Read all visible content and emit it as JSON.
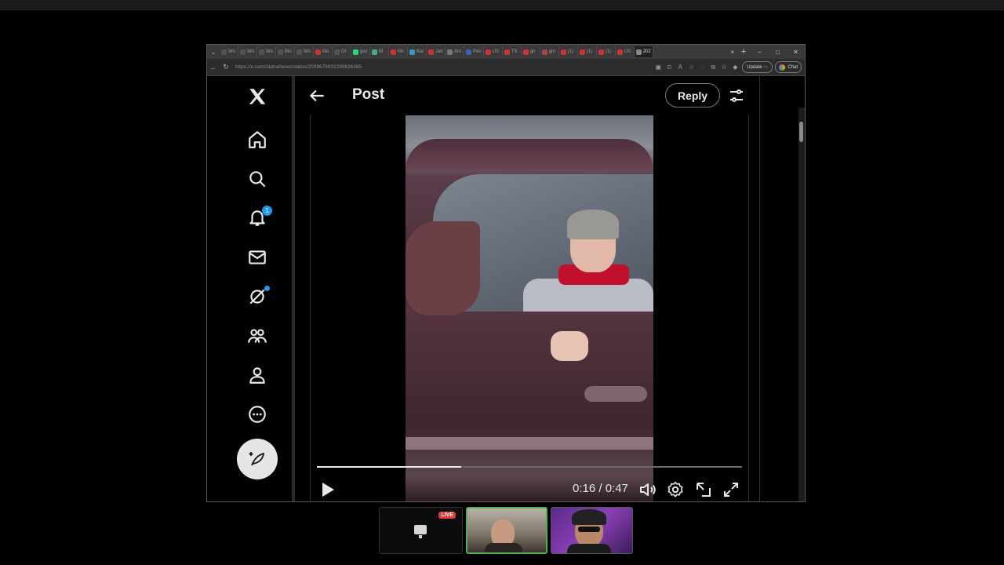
{
  "browser": {
    "tab_labels": [
      "Wo",
      "Wo",
      "Wo",
      "Blo",
      "Wo",
      "Mo",
      "Oi",
      "goc",
      "Bl",
      "Mc",
      "Bar",
      "Jan",
      "Ant",
      "Pen",
      "US",
      "TS",
      "gn",
      "gm",
      "(1)",
      "(1)",
      "(1)",
      "US",
      "202"
    ],
    "new_tab": "+",
    "close_tab": "×",
    "url": "https://x.com/AlphaNews/status/2009679932289626385",
    "update_label": "Update",
    "chat_label": "Chat",
    "window_controls": [
      "–",
      "□",
      "✕"
    ]
  },
  "sidebar": {
    "notifications_badge": "1"
  },
  "header": {
    "title": "Post",
    "reply_label": "Reply"
  },
  "video": {
    "current_time": "0:16",
    "duration": "0:47",
    "time_display": "0:16 / 0:47",
    "progress": 0.34
  },
  "stream": {
    "live_label": "LIVE"
  },
  "colors": {
    "accent": "#1d9bf0",
    "background": "#000000",
    "live": "#e53935"
  }
}
